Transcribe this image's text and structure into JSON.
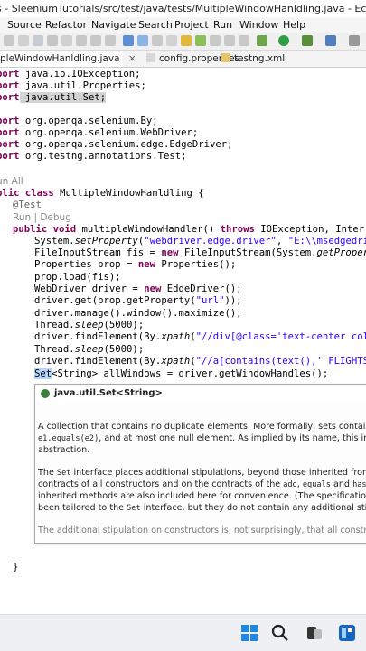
{
  "window": {
    "title": "s - SleeniumTutorials/src/test/java/tests/MultipleWindowHanldling.java - Eclipse IDE"
  },
  "menu": {
    "items": [
      "Source",
      "Refactor",
      "Navigate",
      "Search",
      "Project",
      "Run",
      "Window",
      "Help"
    ]
  },
  "tabs": [
    {
      "label": "pleWindowHanldling.java",
      "close": "×"
    },
    {
      "label": "config.properties"
    },
    {
      "label": "testng.xml"
    }
  ],
  "code": {
    "imports": [
      [
        "port",
        " java.io.IOException;"
      ],
      [
        "port",
        " java.util.Properties;"
      ],
      [
        "port",
        " java.util.Set;"
      ],
      [
        "port",
        " org.openqa.selenium.By;"
      ],
      [
        "port",
        " org.openqa.selenium.WebDriver;"
      ],
      [
        "port",
        " org.openqa.selenium.edge.EdgeDriver;"
      ],
      [
        "port",
        " org.testng.annotations.Test;"
      ]
    ],
    "lens_run_all": "un All",
    "class_decl": [
      "blic class",
      " MultipleWindowHanldling {"
    ],
    "annotation": "@Test",
    "lens_run_debug": "Run | Debug",
    "method_decl": [
      "public void",
      " multipleWindowHandler() ",
      "throws",
      " IOException, Interrupte"
    ],
    "body": {
      "l1a": "System.",
      "l1b": "setProperty",
      "l1c": "(",
      "l1d": "\"webdriver.edge.driver\"",
      "l1e": ", ",
      "l1f": "\"E:\\\\msedgedriver",
      "l2a": "FileInputStream fis = ",
      "l2b": "new",
      "l2c": " FileInputStream(System.",
      "l2d": "getProperty",
      "l2e": "(",
      "l3a": "Properties prop = ",
      "l3b": "new",
      "l3c": " Properties();",
      "l4": "prop.load(fis);",
      "l5a": "WebDriver driver = ",
      "l5b": "new",
      "l5c": " EdgeDriver();",
      "l6a": "driver.get(prop.getProperty(",
      "l6b": "\"url\"",
      "l6c": "));",
      "l7": "driver.manage().window().maximize();",
      "l8a": "Thread.",
      "l8b": "sleep",
      "l8c": "(5000);",
      "l9a": "driver.findElement(By.",
      "l9b": "xpath",
      "l9c": "(",
      "l9d": "\"//div[@class='text-center col-xs",
      "l10a": "Thread.",
      "l10b": "sleep",
      "l10c": "(5000);",
      "l11a": "driver.findElement(By.",
      "l11b": "xpath",
      "l11c": "(",
      "l11d": "\"//a[contains(text(),' FLIGHTS ')",
      "l12a": "Set",
      "l12b": "<String> allWindows = driver.getWindowHandles();"
    },
    "closing_brace": "}"
  },
  "hover": {
    "title": "java.util.Set<String>",
    "p1_line1": "A collection that contains no duplicate elements. More formally, sets contain no pa",
    "p1_code": "e1.equals(e2)",
    "p1_line2_rest": ", and at most one null element. As implied by its name, this interf",
    "p1_line3": "abstraction.",
    "p2_l1a": "The ",
    "p2_l1b": "Set",
    "p2_l1c": " interface places additional stipulations, beyond those inherited from the C",
    "p2_l2a": "contracts of all constructors and on the contracts of the ",
    "p2_l2b": "add",
    "p2_l2c": ", ",
    "p2_l2d": "equals",
    "p2_l2e": " and ",
    "p2_l2f": "hashCo",
    "p2_l3": "inherited methods are also included here for convenience. (The specifications acco",
    "p2_l4a": "been tailored to the ",
    "p2_l4b": "Set",
    "p2_l4c": " interface, but they do not contain any additional stipulatio",
    "p3": "The additional stipulation on constructors is, not surprisingly, that all constructors"
  },
  "colors": {
    "keyword": "#7f0055",
    "string": "#2a00ff",
    "annotation": "#646464",
    "accent": "#3b7fd6"
  }
}
